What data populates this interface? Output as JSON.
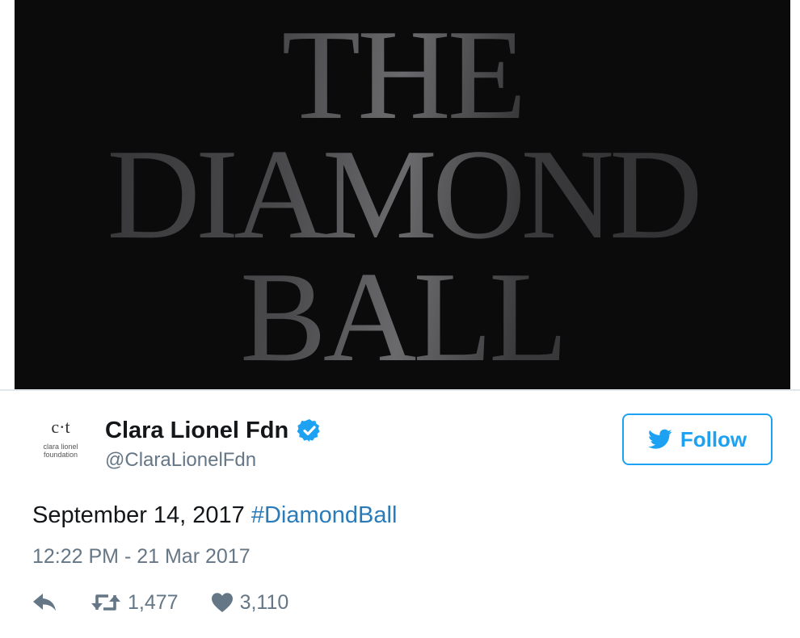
{
  "media": {
    "lines": [
      "THE",
      "DIAMOND",
      "BALL"
    ]
  },
  "author": {
    "display_name": "Clara Lionel Fdn",
    "handle": "@ClaraLionelFdn",
    "avatar_mark": "c·t",
    "avatar_text_line1": "clara lionel",
    "avatar_text_line2": "foundation",
    "verified_icon": "verified-badge-icon"
  },
  "follow": {
    "label": "Follow",
    "icon": "twitter-bird-icon",
    "color": "#1da1f2"
  },
  "tweet": {
    "text": "September 14, 2017 ",
    "hashtag": "#DiamondBall",
    "timestamp": "12:22 PM - 21 Mar 2017"
  },
  "actions": {
    "reply_icon": "reply-icon",
    "retweet_icon": "retweet-icon",
    "retweet_count": "1,477",
    "like_icon": "heart-icon",
    "like_count": "3,110"
  },
  "colors": {
    "accent": "#1da1f2",
    "hashtag": "#2b7bb9",
    "secondary_text": "#657786",
    "media_background": "#0b0b0c"
  }
}
